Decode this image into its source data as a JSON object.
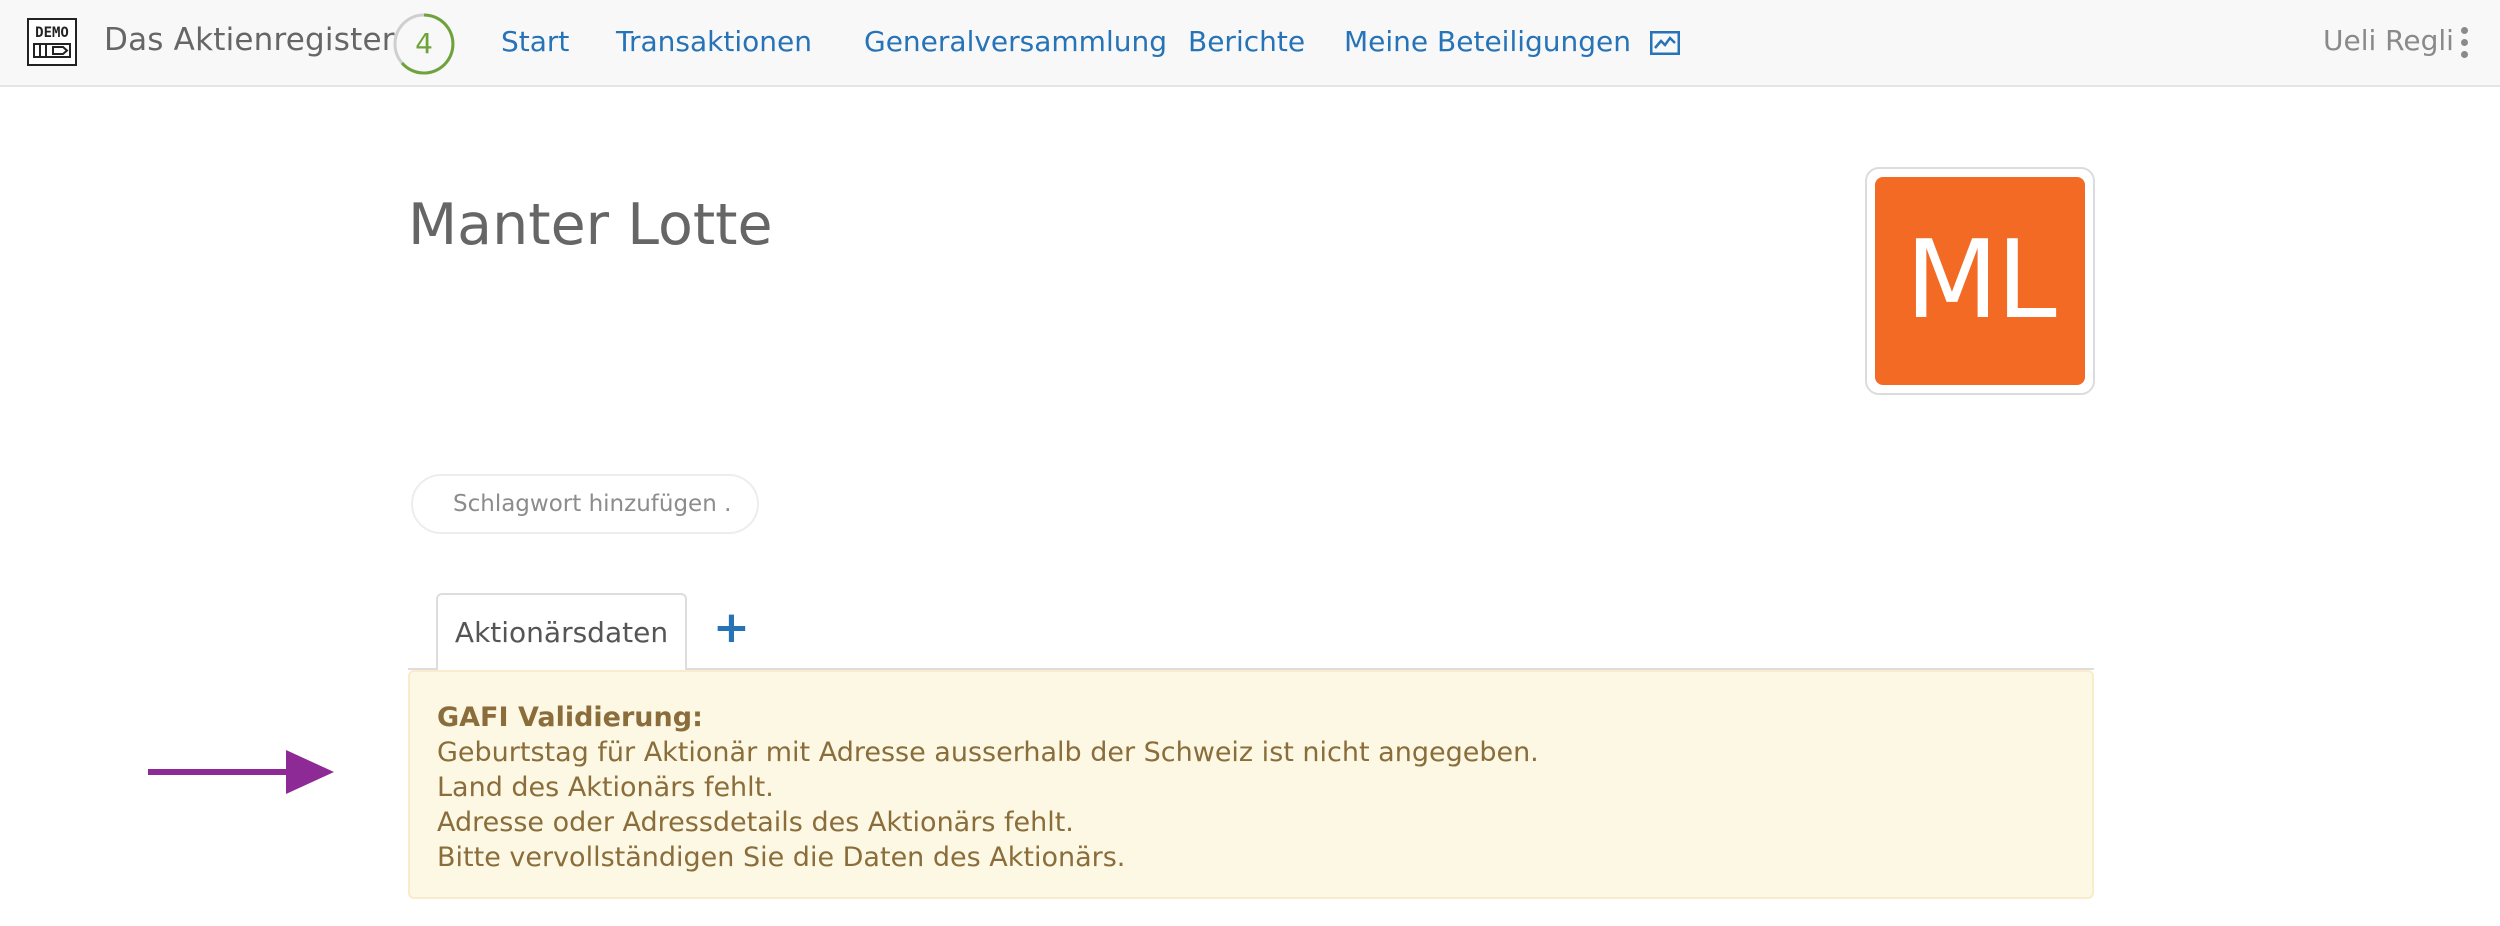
{
  "navbar": {
    "logo_text": "DEMO",
    "brand": "Das Aktienregister",
    "count": "4",
    "links": [
      "Start",
      "Transaktionen",
      "Generalversammlung",
      "Berichte",
      "Meine Beteiligungen"
    ],
    "chart_icon": "line-chart-icon",
    "user": "Ueli Regli",
    "menu_icon": "kebab-menu-icon"
  },
  "profile": {
    "name": "Manter Lotte",
    "initials": "ML",
    "avatar_color": "#f26a23"
  },
  "tag": {
    "placeholder": "Schlagwort hinzufügen ."
  },
  "tabs": {
    "active": "Aktionärsdaten",
    "add_icon": "plus-icon"
  },
  "alert": {
    "title": "GAFI Validierung:",
    "lines": [
      "Geburtstag für Aktionär mit Adresse ausserhalb der Schweiz ist nicht angegeben.",
      "Land des Aktionärs fehlt.",
      "Adresse oder Adressdetails des Aktionärs fehlt.",
      "Bitte vervollständigen Sie die Daten des Aktionärs."
    ],
    "background": "#fcf8e3",
    "text_color": "#8a6d3b"
  },
  "annotation": {
    "arrow_icon": "arrow-right-icon",
    "color": "#8e2a96"
  }
}
